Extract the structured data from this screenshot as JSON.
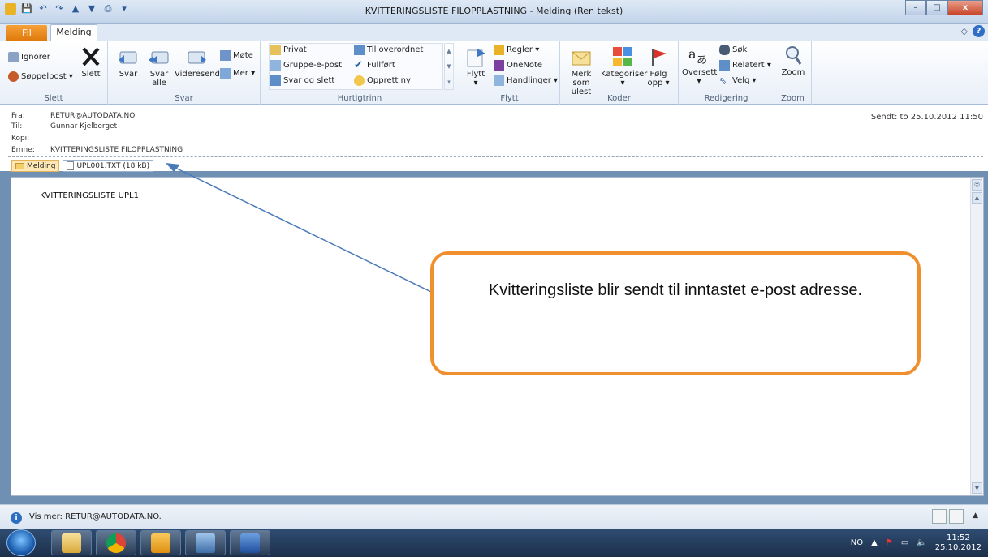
{
  "window": {
    "title": "KVITTERINGSLISTE FILOPPLASTNING - Melding (Ren tekst)",
    "minimize": "–",
    "maximize": "□",
    "close": "x"
  },
  "tabs": {
    "file": "Fil",
    "message": "Melding",
    "collapse": "◇",
    "help": "?"
  },
  "ribbon": {
    "slett": {
      "label": "Slett",
      "ignorer": "Ignorer",
      "soppelpost": "Søppelpost ▾",
      "slett_btn": "Slett"
    },
    "svar": {
      "label": "Svar",
      "svar": "Svar",
      "svar_alle_1": "Svar",
      "svar_alle_2": "alle",
      "videresend": "Videresend",
      "mote": "Møte",
      "mer": "Mer ▾"
    },
    "hurtigtrinn": {
      "label": "Hurtigtrinn",
      "items": [
        "Privat",
        "Gruppe-e-post",
        "Svar og slett",
        "Til overordnet",
        "Fullført",
        "Opprett ny"
      ]
    },
    "flytt": {
      "label": "Flytt",
      "flytt": "Flytt",
      "regler": "Regler ▾",
      "onenote": "OneNote",
      "handlinger": "Handlinger ▾"
    },
    "koder": {
      "label": "Koder",
      "merk_1": "Merk",
      "merk_2": "som ulest",
      "kategoriser": "Kategoriser",
      "folg_1": "Følg",
      "folg_2": "opp ▾"
    },
    "redigering": {
      "label": "Redigering",
      "oversett": "Oversett",
      "sok": "Søk",
      "relatert": "Relatert ▾",
      "velg": "Velg ▾"
    },
    "zoom": {
      "label": "Zoom",
      "zoom": "Zoom"
    }
  },
  "header": {
    "from_label": "Fra:",
    "from": "RETUR@AUTODATA.NO",
    "to_label": "Til:",
    "to": "Gunnar Kjelberget",
    "cc_label": "Kopi:",
    "cc": "",
    "subject_label": "Emne:",
    "subject": "KVITTERINGSLISTE FILOPPLASTNING",
    "sent": "Sendt:  to 25.10.2012 11:50",
    "attachments": [
      "Melding",
      "UPL001.TXT (18 kB)"
    ]
  },
  "body": {
    "text": "KVITTERINGSLISTE UPL1"
  },
  "callout": {
    "text": "Kvitteringsliste blir sendt til inntastet e-post adresse."
  },
  "status": {
    "text": "Vis mer: RETUR@AUTODATA.NO."
  },
  "taskbar": {
    "lang": "NO",
    "time": "11:52",
    "date": "25.10.2012"
  },
  "colors": {
    "callout_border": "#f08f2e",
    "arrow": "#4a79b8",
    "file_tab": "#e07a0c"
  }
}
